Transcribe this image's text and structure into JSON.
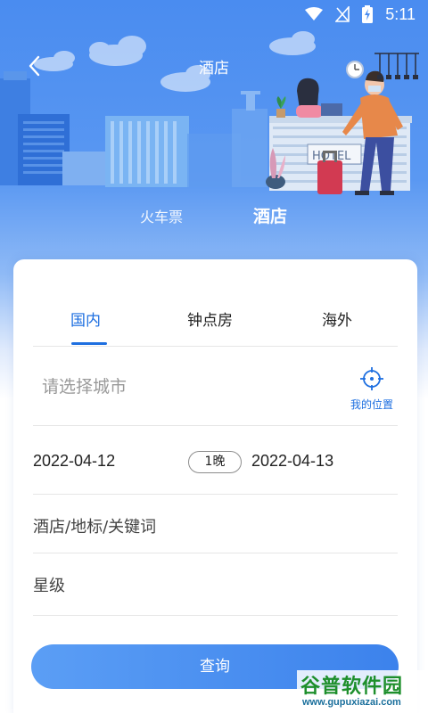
{
  "statusbar": {
    "time": "5:11"
  },
  "header": {
    "title": "酒店"
  },
  "mode_tabs": [
    {
      "label": "火车票"
    },
    {
      "label": "酒店"
    }
  ],
  "region_tabs": [
    {
      "label": "国内",
      "active": true
    },
    {
      "label": "钟点房"
    },
    {
      "label": "海外"
    }
  ],
  "search_form": {
    "city_placeholder": "请选择城市",
    "my_location_label": "我的位置",
    "checkin_date": "2022-04-12",
    "nights": "1晚",
    "checkout_date": "2022-04-13",
    "keyword_placeholder": "酒店/地标/关键词",
    "star_placeholder": "星级",
    "search_button": "查询"
  },
  "hero": {
    "sign_text": "HOTEL"
  },
  "watermark": {
    "text": "谷普软件园",
    "url": "www.gupuxiazai.com"
  },
  "colors": {
    "accent": "#1e6fe0",
    "header_blue": "#4a8cf0",
    "button_start": "#5b9ef5",
    "button_end": "#3c82ec"
  }
}
